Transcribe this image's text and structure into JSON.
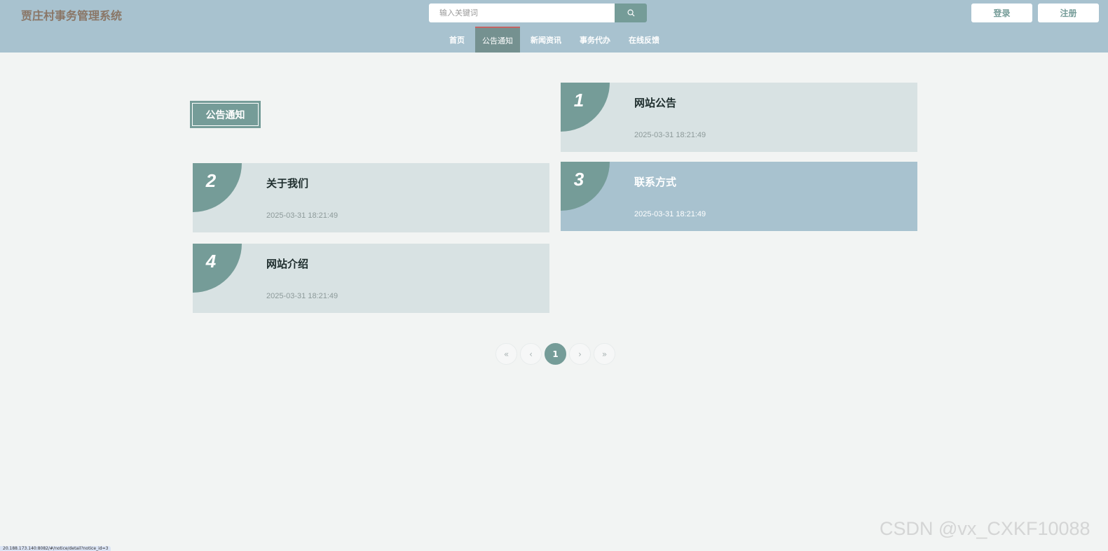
{
  "header": {
    "site_title": "贾庄村事务管理系统",
    "search_placeholder": "输入关键词",
    "search_icon": "search-icon",
    "login_label": "登录",
    "register_label": "注册"
  },
  "nav": {
    "items": [
      {
        "label": "首页"
      },
      {
        "label": "公告通知"
      },
      {
        "label": "新闻资讯"
      },
      {
        "label": "事务代办"
      },
      {
        "label": "在线反馈"
      }
    ],
    "active_index": 1
  },
  "section": {
    "title": "公告通知"
  },
  "notices": [
    {
      "number": "1",
      "title": "网站公告",
      "date": "2025-03-31 18:21:49"
    },
    {
      "number": "2",
      "title": "关于我们",
      "date": "2025-03-31 18:21:49"
    },
    {
      "number": "3",
      "title": "联系方式",
      "date": "2025-03-31 18:21:49"
    },
    {
      "number": "4",
      "title": "网站介绍",
      "date": "2025-03-31 18:21:49"
    }
  ],
  "pagination": {
    "first": "«",
    "prev": "‹",
    "current": "1",
    "next": "›",
    "last": "»"
  },
  "watermark": "CSDN @vx_CXKF10088",
  "status_url": "20.188.173.140:8082/#/notice/detail?notice_id=3",
  "colors": {
    "header_bg": "#a8c2cf",
    "accent": "#759c98",
    "card_bg": "#d8e2e3",
    "page_bg": "#f2f4f3"
  }
}
